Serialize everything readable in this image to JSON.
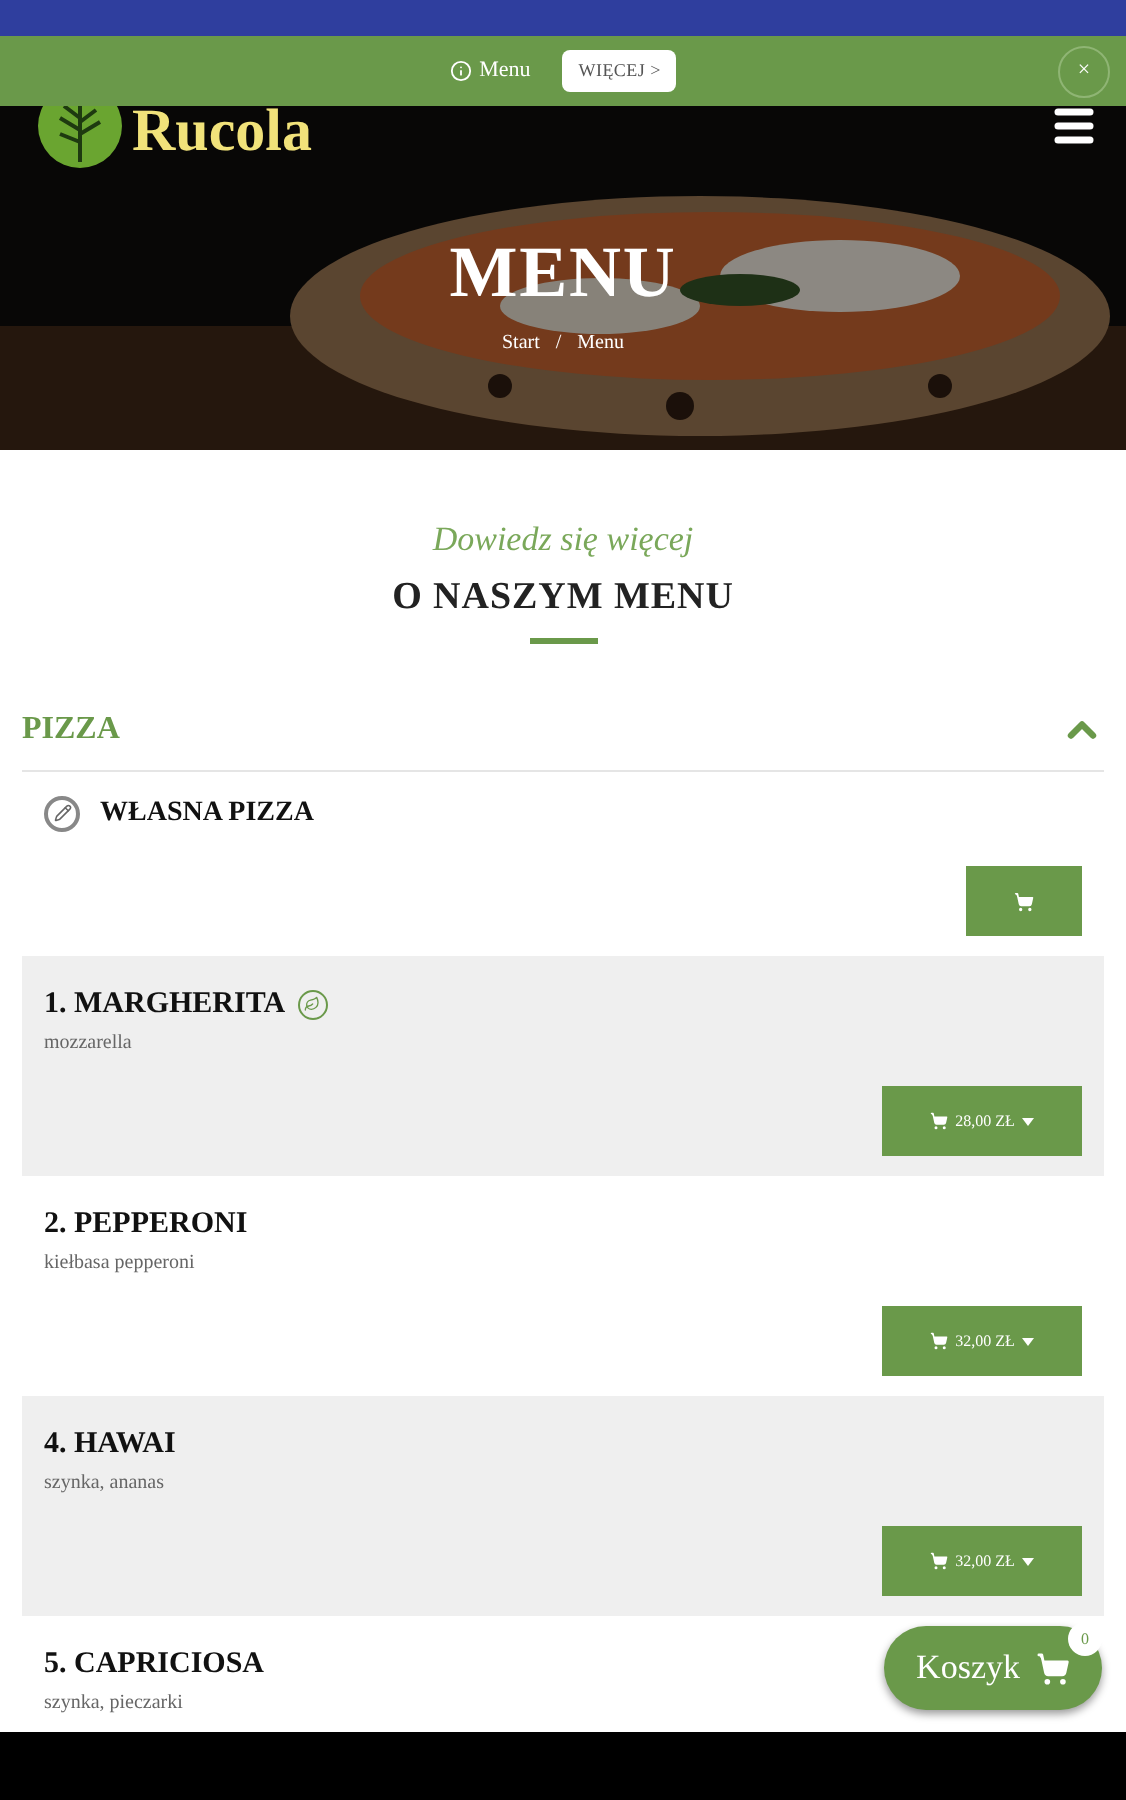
{
  "banner": {
    "text": "Menu",
    "button": "WIĘCEJ >",
    "close": "×"
  },
  "header": {
    "logo": "Rucola"
  },
  "hero": {
    "title": "MENU",
    "breadcrumbs": [
      "Start",
      "Menu"
    ],
    "separator": "/"
  },
  "intro": {
    "subtitle": "Dowiedz się więcej",
    "title": "O NASZYM MENU"
  },
  "category": {
    "name": "PIZZA",
    "expanded": true
  },
  "items": [
    {
      "kind": "custom",
      "name": "WŁASNA PIZZA"
    },
    {
      "kind": "dish",
      "name": "1. MARGHERITA",
      "vegetarian": true,
      "description": "mozzarella",
      "price": "28,00 ZŁ"
    },
    {
      "kind": "dish",
      "name": "2. PEPPERONI",
      "vegetarian": false,
      "description": "kiełbasa pepperoni",
      "price": "32,00 ZŁ"
    },
    {
      "kind": "dish",
      "name": "4. HAWAI",
      "vegetarian": false,
      "description": "szynka, ananas",
      "price": "32,00 ZŁ"
    },
    {
      "kind": "dish",
      "name": "5. CAPRICIOSA",
      "vegetarian": false,
      "description": "szynka, pieczarki"
    }
  ],
  "cart": {
    "label": "Koszyk",
    "count": "0"
  }
}
